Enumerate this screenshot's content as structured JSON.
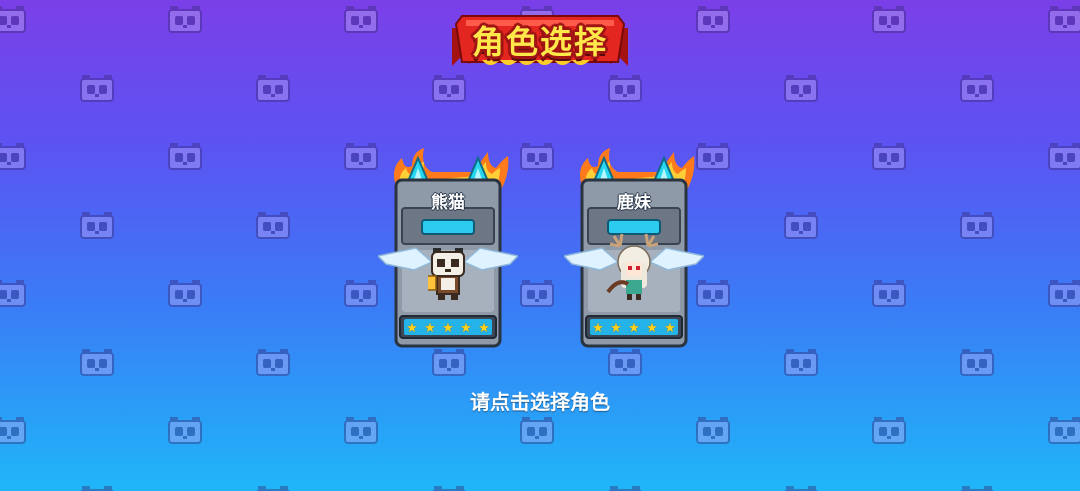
{
  "screen": {
    "title": "角色选择",
    "prompt": "请点击选择角色"
  },
  "characters": [
    {
      "name": "熊猫",
      "stars": 5,
      "icon": "panda-icon"
    },
    {
      "name": "鹿妹",
      "stars": 5,
      "icon": "deer-girl-icon"
    }
  ],
  "colors": {
    "background_top": "#7b3fe8",
    "background_bottom": "#1fb6f8",
    "title_text": "#ffe94a",
    "title_banner": "#d81f1f",
    "crystal": "#2ee0f0",
    "star": "#ffd21f"
  }
}
